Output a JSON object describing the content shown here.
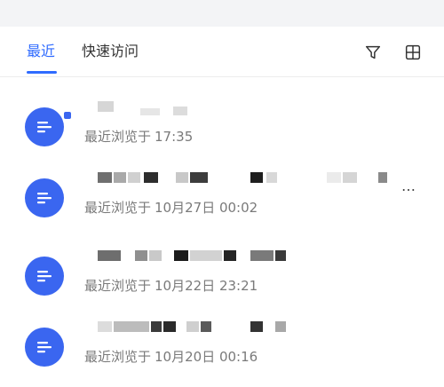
{
  "tabs": [
    {
      "label": "最近"
    },
    {
      "label": "快速访问"
    }
  ],
  "toolbar": {
    "filter_icon": "filter-icon",
    "grid_icon": "grid-view-icon"
  },
  "documents": [
    {
      "meta_prefix": "最近浏览于",
      "time": "17:35"
    },
    {
      "meta_prefix": "最近浏览于",
      "time": "10月27日 00:02"
    },
    {
      "meta_prefix": "最近浏览于",
      "time": "10月22日 23:21"
    },
    {
      "meta_prefix": "最近浏览于",
      "time": "10月20日 00:16"
    }
  ],
  "more_label": "…",
  "colors": {
    "accent": "#2f6bff",
    "doc_icon": "#3a66f0",
    "meta": "#7a7a7a"
  }
}
